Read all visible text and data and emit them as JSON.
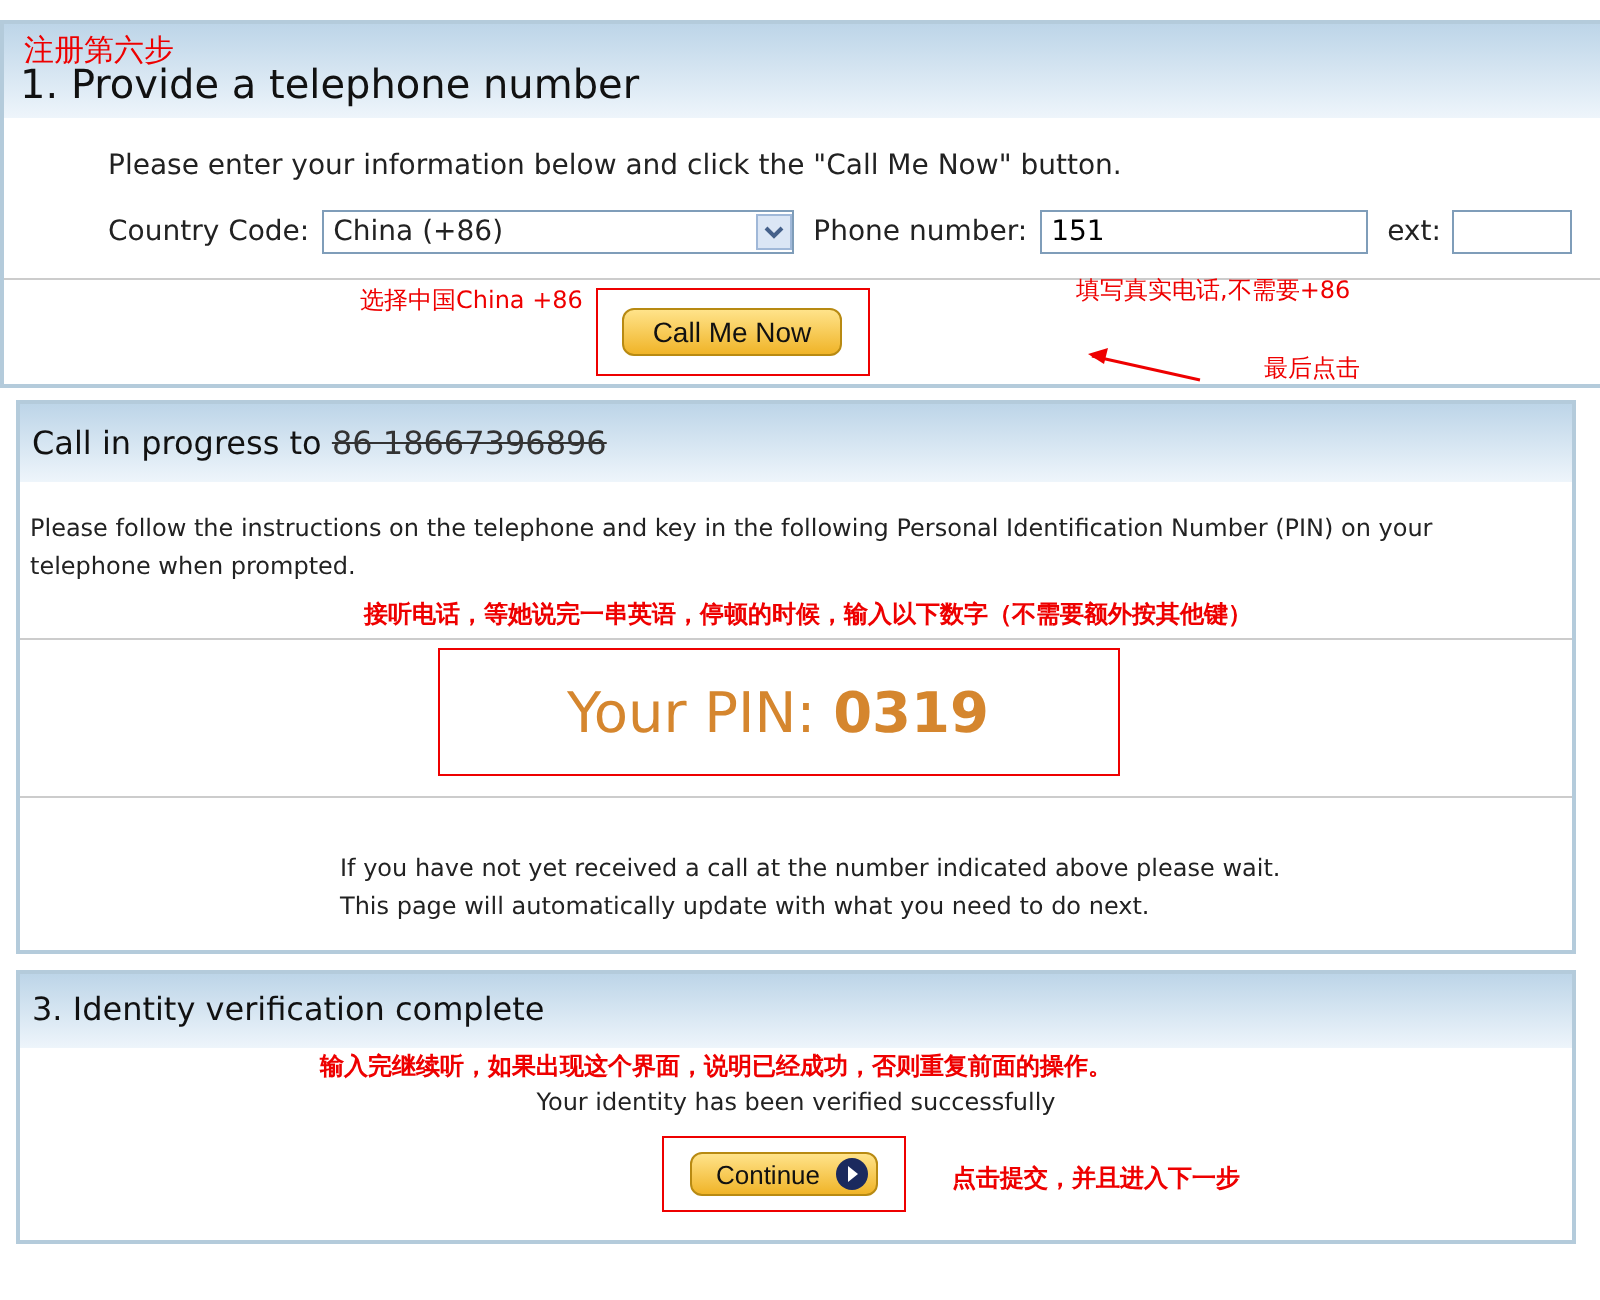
{
  "step_note": "注册第六步",
  "section1": {
    "title": "1. Provide a telephone number",
    "intro": "Please enter your information below and click the \"Call Me Now\" button.",
    "country_label": "Country Code:",
    "country_value": "China (+86)",
    "phone_label": "Phone number:",
    "phone_value": "151",
    "ext_label": "ext:",
    "button": "Call Me Now",
    "note_country": "选择中国China +86",
    "note_phone": "填写真实电话,不需要+86",
    "note_button": "最后点击"
  },
  "section2": {
    "title": "Call in progress to",
    "number": "86 18667396896",
    "instructions": "Please follow the instructions on the telephone and key in the following Personal Identification Number (PIN) on your telephone when prompted.",
    "note": "接听电话，等她说完一串英语，停顿的时候，输入以下数字（不需要额外按其他键）",
    "pin_label": "Your PIN:",
    "pin": "0319",
    "wait": "If you have not yet received a call at the number indicated above please wait. This page will automatically update with what you need to do next."
  },
  "section3": {
    "title": "3. Identity verification complete",
    "note": "输入完继续听，如果出现这个界面，说明已经成功，否则重复前面的操作。",
    "message": "Your identity has been verified successfully",
    "button": "Continue",
    "note_button": "点击提交，并且进入下一步"
  }
}
